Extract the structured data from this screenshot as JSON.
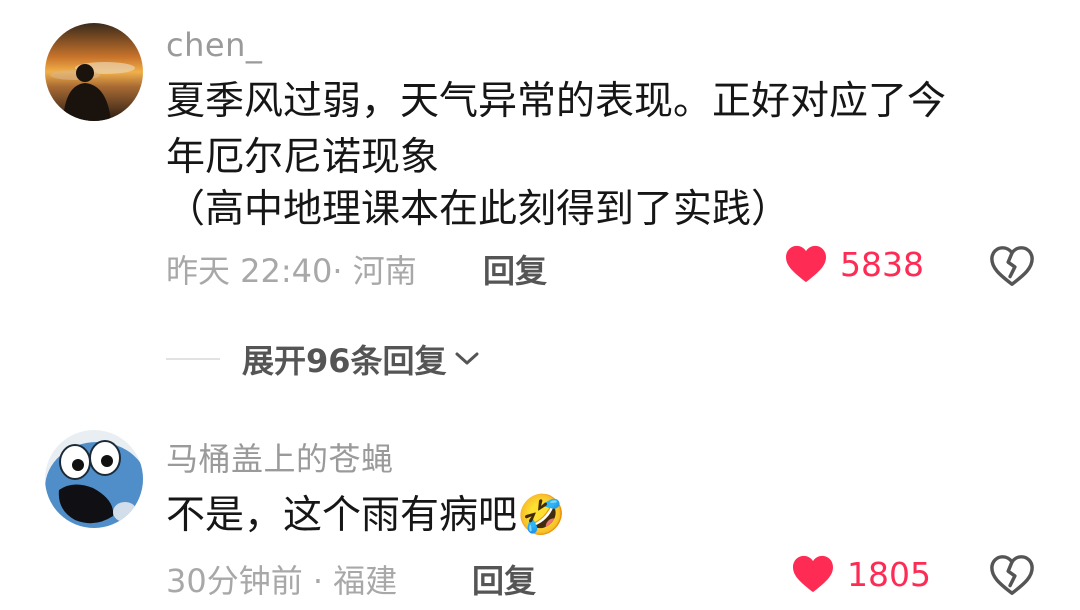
{
  "comments": [
    {
      "username": "chen_",
      "text_lines": [
        "夏季风过弱，天气异常的表现。正好对应了今",
        "年厄尔尼诺现象",
        "（高中地理课本在此刻得到了实践）"
      ],
      "meta": "昨天 22:40· 河南",
      "reply_label": "回复",
      "like_count": "5838",
      "liked": true
    },
    {
      "username": "马桶盖上的苍蝇",
      "text_lines": [
        "不是，这个雨有病吧"
      ],
      "emoji": "🤣",
      "meta": "30分钟前 · 福建",
      "reply_label": "回复",
      "like_count": "1805",
      "liked": true
    }
  ],
  "expand_replies": {
    "label": "展开96条回复"
  },
  "colors": {
    "like": "#fe2c55",
    "text": "#161616",
    "muted": "#a8a8a8"
  }
}
